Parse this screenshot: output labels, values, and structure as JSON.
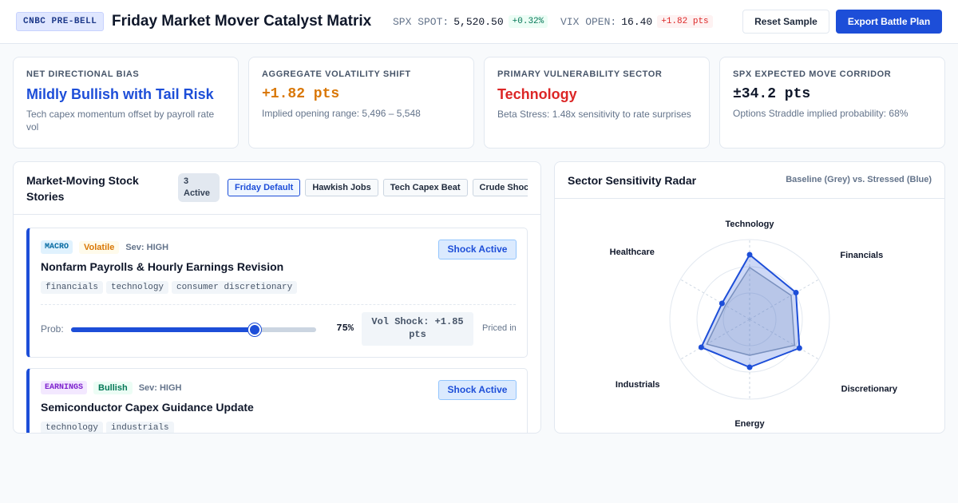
{
  "header": {
    "brand": "CNBC PRE-BELL",
    "title": "Friday Market Mover Catalyst Matrix",
    "spx": {
      "label": "SPX SPOT:",
      "value": "5,520.50",
      "change": "+0.32%"
    },
    "vix": {
      "label": "VIX OPEN:",
      "value": "16.40",
      "change": "+1.82 pts"
    },
    "reset_label": "Reset Sample",
    "export_label": "Export Battle Plan"
  },
  "metrics": [
    {
      "label": "Net Directional Bias",
      "value": "Mildly Bullish with Tail Risk",
      "sub": "Tech capex momentum offset by payroll rate vol",
      "color": "#1d4ed8"
    },
    {
      "label": "Aggregate Volatility Shift",
      "value": "+1.82 pts",
      "sub": "Implied opening range: 5,496 – 5,548",
      "color": "#d97706"
    },
    {
      "label": "Primary Vulnerability Sector",
      "value": "Technology",
      "sub": "Beta Stress: 1.48x sensitivity to rate surprises",
      "color": "#dc2626"
    },
    {
      "label": "SPX Expected Move Corridor",
      "value": "±34.2 pts",
      "sub": "Options Straddle implied probability: 68%",
      "color": "#0f172a"
    }
  ],
  "stories": {
    "title": "Market-Moving Stock Stories",
    "active_count": "3 Active",
    "presets": [
      "Friday Default",
      "Hawkish Jobs",
      "Tech Capex Beat",
      "Crude Shock"
    ],
    "items": [
      {
        "category": "MACRO",
        "mood": "Volatile",
        "severity": "Sev: HIGH",
        "shock_label": "Shock Active",
        "title": "Nonfarm Payrolls & Hourly Earnings Revision",
        "sectors": [
          "financials",
          "technology",
          "consumer discretionary"
        ],
        "prob_label": "Prob:",
        "prob": 75,
        "prob_text": "75%",
        "vol_shock": "Vol Shock: +1.85 pts",
        "priced_label": "Priced in"
      },
      {
        "category": "EARNINGS",
        "mood": "Bullish",
        "severity": "Sev: HIGH",
        "shock_label": "Shock Active",
        "title": "Semiconductor Capex Guidance Update",
        "sectors": [
          "technology",
          "industrials"
        ]
      }
    ]
  },
  "radar": {
    "title": "Sector Sensitivity Radar",
    "legend": "Baseline (Grey) vs. Stressed (Blue)"
  },
  "chart_data": {
    "type": "radar",
    "axes": [
      "Technology",
      "Financials",
      "Discretionary",
      "Energy",
      "Industrials",
      "Healthcare"
    ],
    "max": 1.0,
    "series": [
      {
        "name": "Baseline",
        "color": "#94a3b8",
        "values": [
          0.65,
          0.6,
          0.65,
          0.45,
          0.62,
          0.35
        ]
      },
      {
        "name": "Stressed",
        "color": "#1d4ed8",
        "values": [
          0.81,
          0.67,
          0.72,
          0.6,
          0.7,
          0.4
        ]
      }
    ]
  },
  "colors": {
    "accent": "#1d4ed8",
    "up": "#047857",
    "down": "#dc2626",
    "warn": "#d97706"
  }
}
